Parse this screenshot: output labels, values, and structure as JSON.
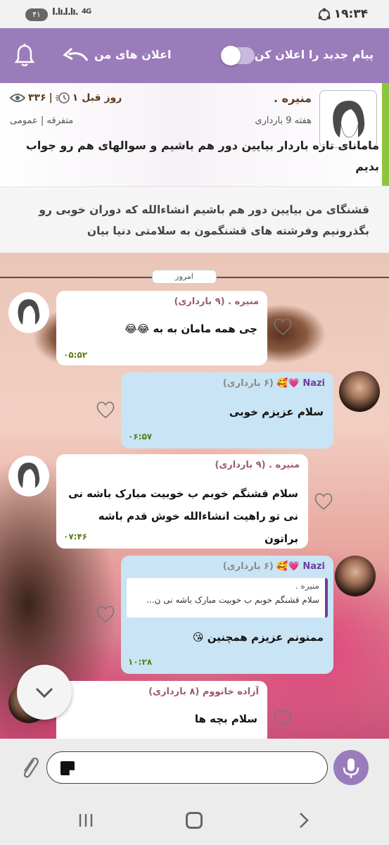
{
  "status_bar": {
    "time": "۱۹:۳۴",
    "battery": "۴۱",
    "network": "4G"
  },
  "topbar": {
    "notify_new_label": "پیام جدید را اعلان کن",
    "my_notifications_label": "اعلان های من"
  },
  "post": {
    "author": "منیره .",
    "week": "هفته 9 بارداری",
    "time_ago": "۱ روز قبل",
    "views": "۳۳۶",
    "category": "متفرقه | عمومی",
    "title": "مامانای تازه باردار بیایین دور هم باشیم و سوالهای هم رو جواب بدیم"
  },
  "description": "قشنگای من بیایین دور هم باشیم انشاءالله که دوران خوبی رو بگذرونیم وفرشته های قشنگمون به سلامتی دنیا بیان",
  "chat": {
    "date_chip": "امروز",
    "messages": [
      {
        "sender": "منیره . (۹ بارداری)",
        "text": "چی همه مامان به به 😂😂",
        "time": "۰۵:۵۲"
      },
      {
        "sender_nick": "Nazi",
        "sender_emoji": "💗🥰",
        "sender_week": "(۶ بارداری)",
        "text": "سلام عزیزم خوبی",
        "time": "۰۶:۵۷"
      },
      {
        "sender": "منیره . (۹ بارداری)",
        "text": "سلام قشنگم خوبم ب خوبیت مبارک باشه نی نی تو راهیت انشاءالله خوش قدم باشه براتون",
        "time": "۰۷:۴۶"
      },
      {
        "sender_nick": "Nazi",
        "sender_emoji": "💗🥰",
        "sender_week": "(۶ بارداری)",
        "quote_name": "منیره .",
        "quote_text": "سلام قشنگم خوبم ب خوبیت مبارک باشه نی ن...",
        "text": "ممنونم عزیزم همچنین 😘",
        "time": "۱۰:۲۸"
      },
      {
        "sender": "آزاده خانووم (۸ بارداری)",
        "text": "سلام بچه ها"
      }
    ]
  },
  "icons": {
    "bell": "bell-icon",
    "back": "back-arrow-icon",
    "eye": "eye-icon",
    "clock": "clock-icon",
    "heart": "heart-icon",
    "attach": "paperclip-icon",
    "mic": "microphone-icon",
    "chevron": "chevron-down-icon"
  },
  "colors": {
    "accent": "#9b7cbb",
    "outgoing_bubble": "#c9e4f4",
    "incoming_bubble": "#ffffff",
    "post_accent": "#8cc63f",
    "time": "#5c7d16"
  }
}
